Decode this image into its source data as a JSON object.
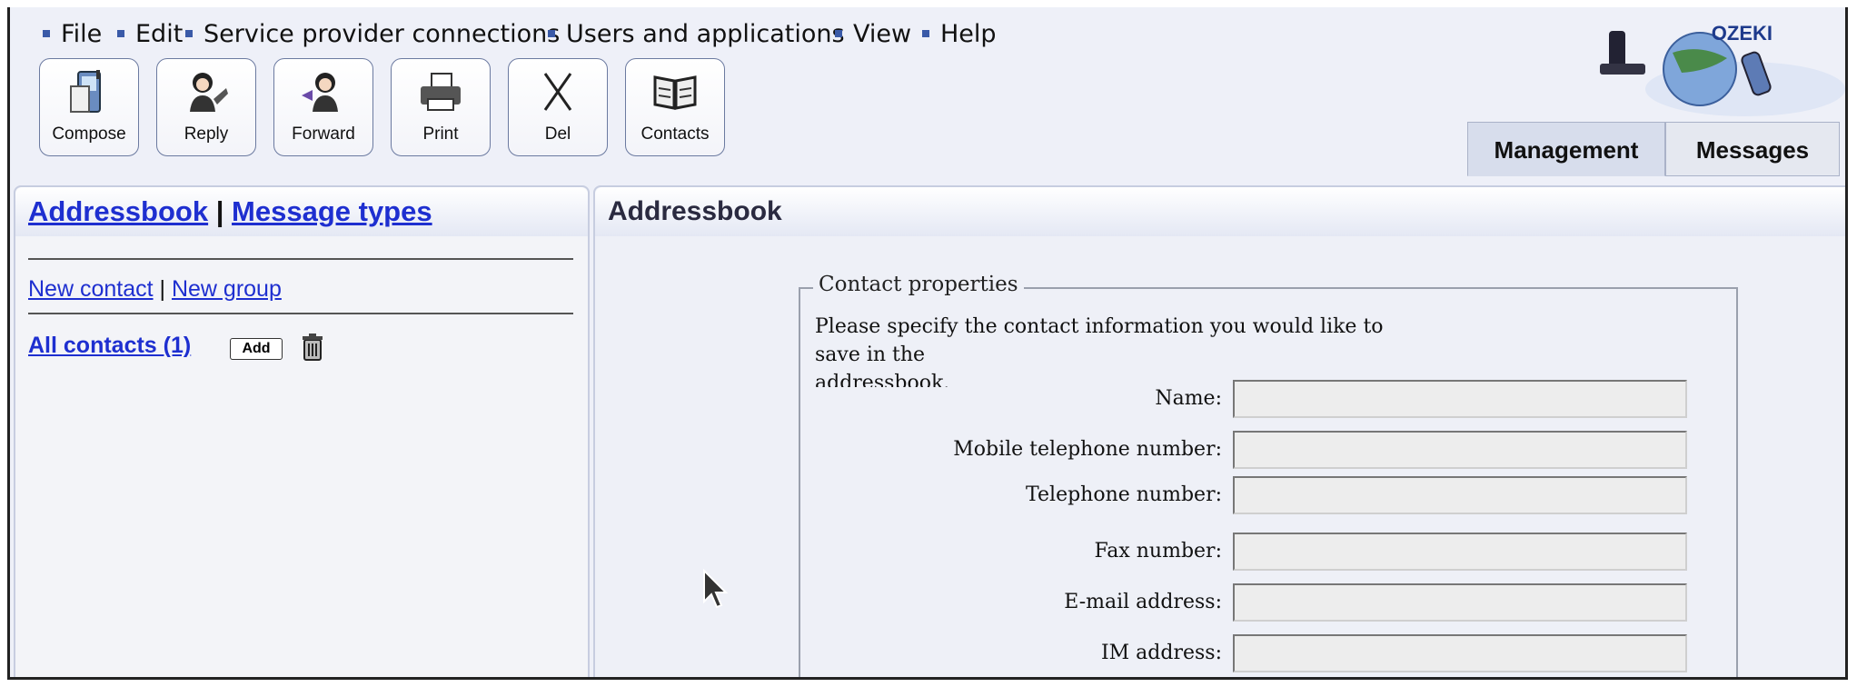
{
  "menu": {
    "items": [
      {
        "label": "File"
      },
      {
        "label": "Edit"
      },
      {
        "label": "Service provider connections"
      },
      {
        "label": "Users and applications"
      },
      {
        "label": "View"
      },
      {
        "label": "Help"
      }
    ]
  },
  "toolbar": {
    "buttons": [
      {
        "label": "Compose",
        "icon": "compose-icon"
      },
      {
        "label": "Reply",
        "icon": "reply-icon"
      },
      {
        "label": "Forward",
        "icon": "forward-icon"
      },
      {
        "label": "Print",
        "icon": "print-icon"
      },
      {
        "label": "Del",
        "icon": "delete-icon"
      },
      {
        "label": "Contacts",
        "icon": "contacts-icon"
      }
    ]
  },
  "logo": {
    "text": "OZEKI"
  },
  "tabs": [
    {
      "label": "Management",
      "active": true
    },
    {
      "label": "Messages",
      "active": false
    }
  ],
  "left": {
    "header_links": [
      "Addressbook",
      "Message types"
    ],
    "header_sep": "|",
    "subnav": [
      "New contact",
      "New group"
    ],
    "subnav_sep": "|",
    "all_contacts": "All contacts (1)",
    "add_label": "Add"
  },
  "right": {
    "title": "Addressbook",
    "form": {
      "legend": "Contact properties",
      "intro_lines": [
        "Please specify the contact information you would like to",
        "save in the",
        "addressbook."
      ],
      "fields": [
        {
          "label": "Name:",
          "value": ""
        },
        {
          "label": "Mobile telephone number:",
          "value": ""
        },
        {
          "label": "Telephone number:",
          "value": ""
        },
        {
          "label": "Fax number:",
          "value": ""
        },
        {
          "label": "E-mail address:",
          "value": ""
        },
        {
          "label": "IM address:",
          "value": ""
        }
      ]
    }
  },
  "colors": {
    "link": "#1e2fd0",
    "background": "#eef0f8",
    "tab_active": "#d7ddec"
  }
}
